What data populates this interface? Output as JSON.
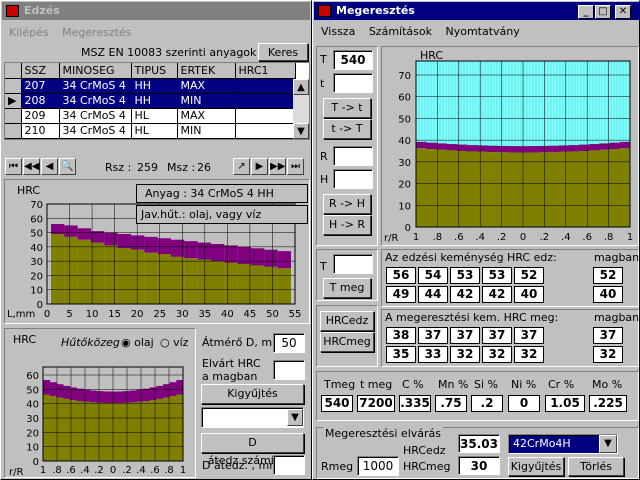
{
  "win1": {
    "title": "Edzés",
    "menu": [
      "Kilépés",
      "Megeresztés"
    ],
    "table_title": "MSZ EN 10083 szerinti anyagok",
    "search_btn": "Keres",
    "headers": [
      "SSZ",
      "MINOSEG",
      "TIPUS",
      "ERTEK",
      "HRC1"
    ],
    "rows": [
      [
        "207",
        "34 CrMoS 4",
        "HH",
        "MAX"
      ],
      [
        "208",
        "34 CrMoS 4",
        "HH",
        "MIN"
      ],
      [
        "209",
        "34 CrMoS 4",
        "HL",
        "MAX"
      ],
      [
        "210",
        "34 CrMoS 4",
        "HL",
        "MIN"
      ]
    ],
    "nav": {
      "rsz_label": "Rsz :",
      "rsz": "259",
      "msz_label": "Msz :",
      "msz": "26"
    },
    "tooltip1": "Anyag : 34 CrMoS 4  HH",
    "tooltip2": "Jav.hűt.: olaj, vagy víz",
    "chart1": {
      "ylabel": "HRC",
      "xlabel": "L,mm",
      "yticks": [
        "70",
        "60",
        "50",
        "40",
        "30",
        "20",
        "10",
        "0"
      ],
      "xticks": [
        "0",
        "5",
        "10",
        "15",
        "20",
        "25",
        "30",
        "35",
        "40",
        "45",
        "50",
        "55"
      ]
    },
    "chart2": {
      "ylabel": "HRC",
      "medium_label": "Hűtőközeg :",
      "radio_oil": "olaj",
      "radio_water": "víz",
      "xlabel": "r/R",
      "yticks": [
        "60",
        "50",
        "40",
        "30",
        "20",
        "10",
        "0"
      ],
      "xticks": [
        "1",
        ".8",
        ".6",
        ".4",
        ".2",
        "0",
        ".2",
        ".4",
        ".6",
        ".8",
        "1"
      ]
    },
    "diam_label": "Átmérő D, mm",
    "diam": "50",
    "expected_label1": "Elvárt HRC",
    "expected_label2": "a magban",
    "expected": "",
    "collect_btn": "Kigyűjtés",
    "dcalc_btn": "D átedz.számítása",
    "dcrit_label": "D átedz. , mm",
    "dcrit": ""
  },
  "win2": {
    "title": "Megeresztés",
    "menu": [
      "Vissza",
      "Számítások",
      "Nyomtatvány"
    ],
    "T_label": "T",
    "T": "540",
    "t_label": "t",
    "t": "",
    "btn_T_t": "T -> t",
    "btn_t_T": "t -> T",
    "R_label": "R",
    "H_label": "H",
    "btn_R_H": "R -> H",
    "btn_H_R": "H -> R",
    "T2_label": "T",
    "btn_Tmeg": "T meg",
    "chart": {
      "ylabel": "HRC",
      "xlabel": "r/R",
      "yticks": [
        "70",
        "60",
        "50",
        "40",
        "30",
        "20",
        "10",
        "0"
      ],
      "xticks": [
        "1",
        ".8",
        ".6",
        ".4",
        ".2",
        "0",
        ".2",
        ".4",
        ".6",
        ".8",
        "1"
      ]
    },
    "btn_hrcedz": "HRCedz",
    "btn_hrcmeg": "HRCmeg",
    "edz_title": "Az edzési keménység HRC edz:",
    "magban": "magban",
    "edz_row1": [
      "56",
      "54",
      "53",
      "53",
      "52"
    ],
    "edz_row2": [
      "49",
      "44",
      "42",
      "42",
      "40"
    ],
    "edz_core": [
      "52",
      "40"
    ],
    "meg_title": "A megeresztési kem. HRC meg:",
    "meg_row1": [
      "38",
      "37",
      "37",
      "37",
      "37"
    ],
    "meg_row2": [
      "35",
      "33",
      "32",
      "32",
      "32"
    ],
    "meg_core": [
      "37",
      "32"
    ],
    "res_headers": [
      "Tmeg",
      "t meg",
      "C %",
      "Mn %",
      "Si %",
      "Ni %",
      "Cr %",
      "Mo %"
    ],
    "res_values": [
      "540",
      "7200",
      ".335",
      ".75",
      ".2",
      "0",
      "1.05",
      ".225"
    ],
    "req_title": "Megeresztési elvárás",
    "rmeg_label": "Rmeg",
    "rmeg": "1000",
    "hrcedz_label": "HRCedz",
    "hrcedz": "35.03",
    "hrcmeg_label": "HRCmeg",
    "hrcmeg": "30",
    "steel": "42CrMo4H",
    "collect_btn": "Kigyűjtés",
    "delete_btn": "Törlés"
  },
  "colors": {
    "titlebar": "#000080",
    "purple": "#800080",
    "olive": "#808000",
    "cyan": "#80ffff"
  }
}
